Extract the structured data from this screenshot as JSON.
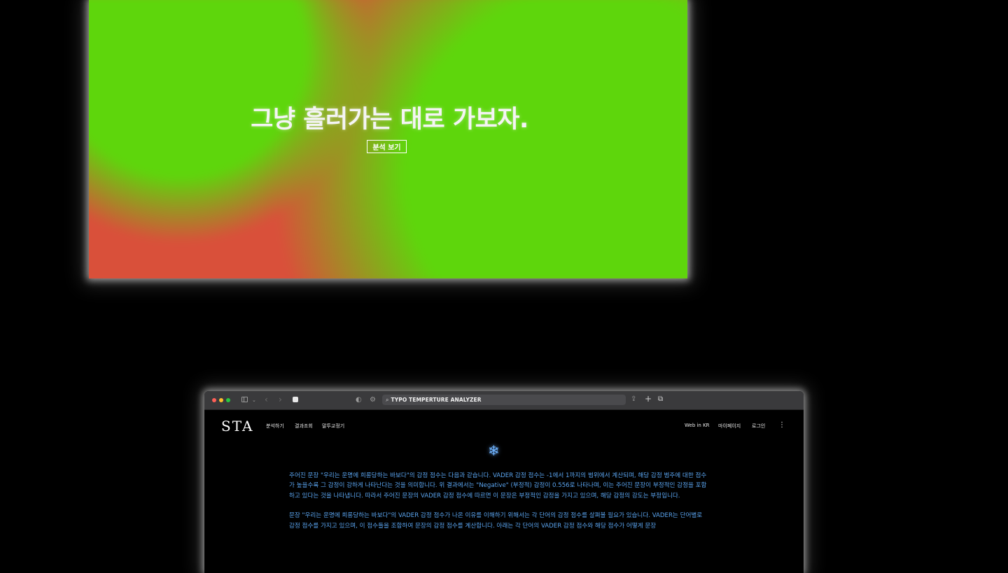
{
  "hero": {
    "title": "그냥 흘러가는 대로 가보자.",
    "button": "분석 보기",
    "colors": {
      "green": "#5ed60c",
      "red": "#d9503a"
    }
  },
  "browser": {
    "address": "TYPO TEMPERTURE ANALYZER"
  },
  "site": {
    "logo": "STA",
    "nav_left": [
      "분석하기",
      "결과조회",
      "말투교정기"
    ],
    "nav_right": [
      "Web in KR",
      "마이페이지",
      "로그인"
    ],
    "menu_icon": "kebab-icon",
    "accent_icon": "snowflake-icon",
    "accent_color": "#5aa4ef",
    "paragraphs": [
      "주어진 문장 \"우리는 운명에 희롱당하는 바보다\"의 감정 점수는 다음과 같습니다. VADER 감정 점수는 -1에서 1까지의 범위에서 계산되며, 해당 감정 범주에 대한 점수가 높을수록 그 감정이 강하게 나타난다는 것을 의미합니다. 위 결과에서는 \"Negative\" (부정적) 감정이 0.556로 나타나며, 이는 주어진 문장이 부정적인 감정을 포함하고 있다는 것을 나타냅니다. 따라서 주어진 문장의 VADER 감정 점수에 따르면 이 문장은 부정적인 감정을 가지고 있으며, 해당 감정의 강도는 부정입니다.",
      "문장 \"우리는 운명에 희롱당하는 바보다\"의 VADER 감정 점수가 나온 이유를 이해하기 위해서는 각 단어의 감정 점수를 살펴볼 필요가 있습니다. VADER는 단어별로 감정 점수를 가지고 있으며, 이 점수들을 조합하여 문장의 감정 점수를 계산합니다. 아래는 각 단어의 VADER 감정 점수와 해당 점수가 어떻게 문장"
    ]
  }
}
